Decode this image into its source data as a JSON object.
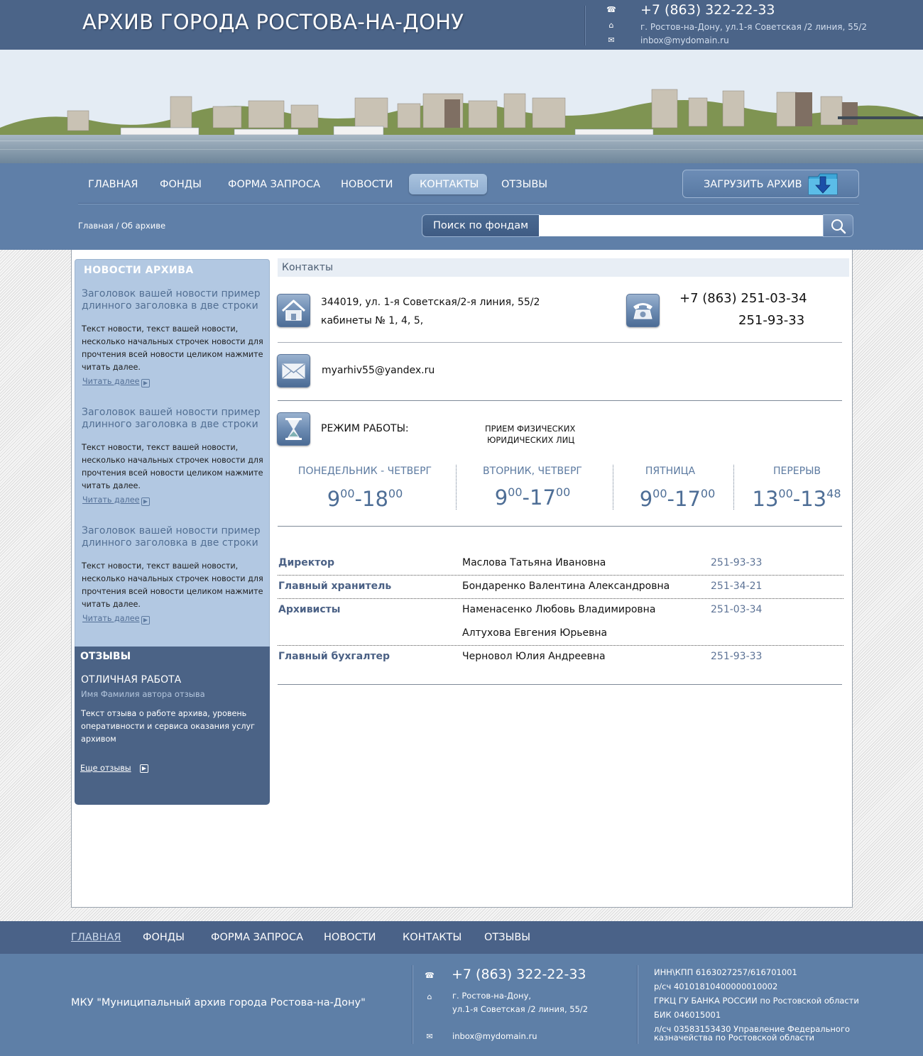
{
  "header": {
    "title": "АРХИВ ГОРОДА РОСТОВА-НА-ДОНУ",
    "phone": "+7 (863) 322-22-33",
    "address": "г. Ростов-на-Дону, ул.1-я Советская /2 линия, 55/2",
    "email": "inbox@mydomain.ru",
    "icons": [
      "phone-icon",
      "home-icon",
      "mail-icon"
    ]
  },
  "nav": {
    "items": [
      "ГЛАВНАЯ",
      "ФОНДЫ",
      "ФОРМА ЗАПРОСА",
      "НОВОСТИ",
      "КОНТАКТЫ",
      "ОТЗЫВЫ"
    ],
    "active": "КОНТАКТЫ",
    "upload_label": "ЗАГРУЗИТЬ АРХИВ"
  },
  "breadcrumb": "Главная / Об архиве",
  "search": {
    "label": "Поиск по фондам",
    "value": ""
  },
  "sidebar": {
    "news_title": "НОВОСТИ АРХИВА",
    "news": [
      {
        "headline": "Заголовок вашей новости пример длинного заголовка в две строки",
        "text": "Текст новости, текст вашей новости, несколько начальных строчек новости для прочтения всей новости целиком нажмите читать далее.",
        "more": "Читать далее"
      },
      {
        "headline": "Заголовок вашей новости пример длинного заголовка в две строки",
        "text": "Текст новости, текст вашей новости, несколько начальных строчек новости для прочтения всей новости целиком нажмите читать далее.",
        "more": "Читать далее"
      },
      {
        "headline": "Заголовок вашей новости пример длинного заголовка в две строки",
        "text": "Текст новости, текст вашей новости, несколько начальных строчек новости для прочтения всей новости целиком нажмите читать далее.",
        "more": "Читать далее"
      }
    ],
    "reviews_title": "ОТЗЫВЫ",
    "review": {
      "headline": "ОТЛИЧНАЯ РАБОТА",
      "author": "Имя Фамилия автора отзыва",
      "text": "Текст отзыва о работе архива, уровень оперативности и сервиса оказания услуг архивом",
      "more": "Еще отзывы"
    }
  },
  "main": {
    "title": "Контакты",
    "address_line1": "344019, ул. 1-я Советская/2-я линия, 55/2",
    "address_line2": "кабинеты № 1, 4, 5,",
    "phone1": "+7 (863) 251-03-34",
    "phone2": "251-93-33",
    "email": "myarhiv55@yandex.ru",
    "hours_label": "РЕЖИМ РАБОТЫ:",
    "reception_line1": "ПРИЕМ ФИЗИЧЕСКИХ",
    "reception_line2": "ЮРИДИЧЕСКИХ ЛИЦ",
    "schedule": [
      {
        "days": "ПОНЕДЕЛЬНИК - ЧЕТВЕРГ",
        "from_h": "9",
        "from_m": "00",
        "to_h": "18",
        "to_m": "00"
      },
      {
        "days": "ВТОРНИК, ЧЕТВЕРГ",
        "from_h": "9",
        "from_m": "00",
        "to_h": "17",
        "to_m": "00"
      },
      {
        "days": "ПЯТНИЦА",
        "from_h": "9",
        "from_m": "00",
        "to_h": "17",
        "to_m": "00"
      },
      {
        "days": "ПЕРЕРЫВ",
        "from_h": "13",
        "from_m": "00",
        "to_h": "13",
        "to_m": "48"
      }
    ],
    "staff": [
      {
        "role": "Директор",
        "name": "Маслова Татьяна Ивановна",
        "phone": "251-93-33"
      },
      {
        "role": "Главный хранитель",
        "name": "Бондаренко Валентина Александровна",
        "phone": "251-34-21"
      },
      {
        "role": "Архивисты",
        "name": "Наменасенко Любовь Владимировна",
        "phone": "251-03-34"
      },
      {
        "role": "",
        "name": "Алтухова Евгения Юрьевна",
        "phone": ""
      },
      {
        "role": "Главный бухгалтер",
        "name": "Черновол Юлия Андреевна",
        "phone": "251-93-33"
      }
    ]
  },
  "footer": {
    "nav": [
      "ГЛАВНАЯ",
      "ФОНДЫ",
      "ФОРМА ЗАПРОСА",
      "НОВОСТИ",
      "КОНТАКТЫ",
      "ОТЗЫВЫ"
    ],
    "org": "МКУ \"Муниципальный архив города Ростова-на-Дону\"",
    "phone": "+7 (863) 322-22-33",
    "address1": "г. Ростов-на-Дону,",
    "address2": "ул.1-я Советская /2 линия, 55/2",
    "email": "inbox@mydomain.ru",
    "requisites": [
      "ИНН\\КПП 6163027257/616701001",
      "р/сч 40101810400000010002",
      "ГРКЦ ГУ БАНКА РОССИИ по Ростовской области",
      "БИК 046015001",
      "л/сч 03583153430 Управление Федерального",
      "казначейства по Ростовской области"
    ]
  }
}
